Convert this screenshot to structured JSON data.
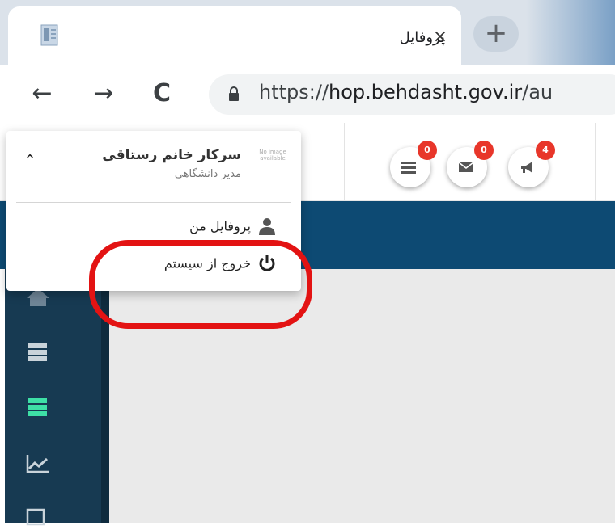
{
  "browser": {
    "tab_title": "پروفایل",
    "tab_close": "×",
    "new_tab": "+",
    "back": "←",
    "forward": "→",
    "reload": "C",
    "url_scheme": "https://",
    "url_host": "hop.behdasht.gov.ir",
    "url_path": "/au"
  },
  "header": {
    "notifications": [
      {
        "name": "menu",
        "icon": "list-icon",
        "count": "0"
      },
      {
        "name": "messages",
        "icon": "envelope-icon",
        "count": "0"
      },
      {
        "name": "announcements",
        "icon": "megaphone-icon",
        "count": "4"
      }
    ]
  },
  "user_menu": {
    "name": "سرکار خانم  رستاقی",
    "role": "مدیر دانشگاهی",
    "avatar_text": "No image available",
    "items": [
      {
        "label": "پروفایل من",
        "icon": "user-icon"
      },
      {
        "label": "خروج از سیستم",
        "icon": "power-icon"
      }
    ]
  },
  "sidebar": {
    "icons": [
      "home-icon",
      "server-icon",
      "server-active-icon",
      "chart-icon",
      "edit-icon"
    ],
    "active_color": "#3ee0a6"
  },
  "colors": {
    "navband": "#0d4a73",
    "sidebar": "#173a52",
    "badge": "#e8362a",
    "highlight": "#e31313"
  }
}
